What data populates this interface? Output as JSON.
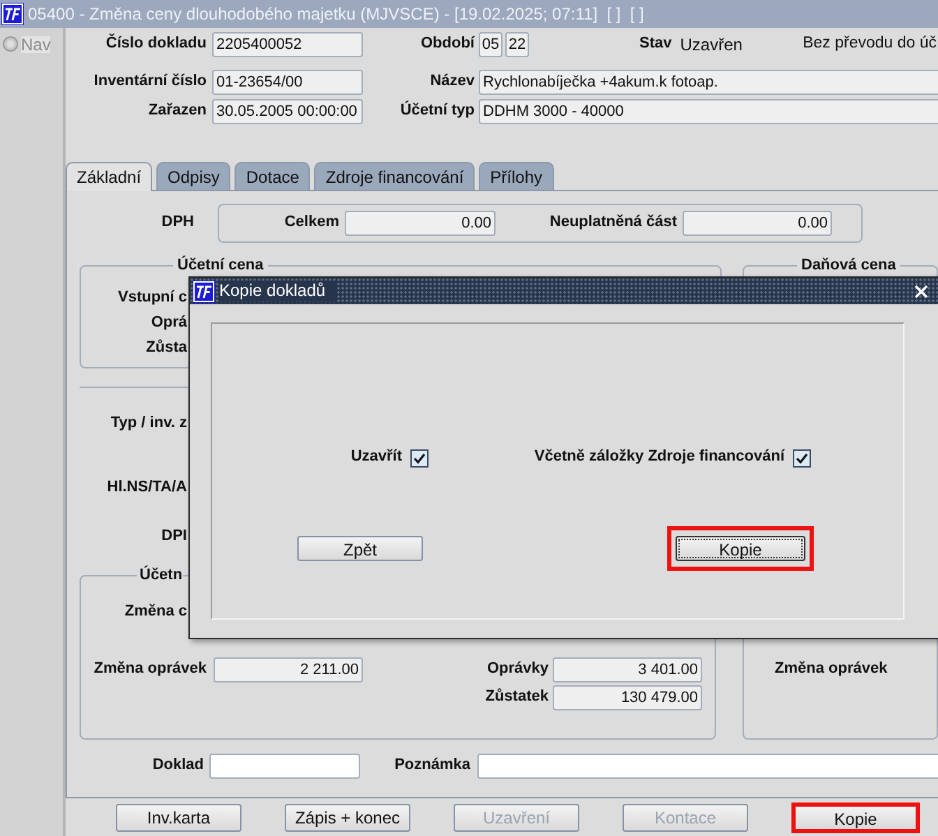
{
  "window": {
    "title": "05400 - Změna ceny dlouhodobého majetku (MJVSCE) - [19.02.2025; 07:11]  [ ]  [ ]"
  },
  "sidebar": {
    "items": [
      {
        "label": "Nav",
        "selected": false
      }
    ]
  },
  "header": {
    "cislo_dokladu": {
      "label": "Číslo dokladu",
      "value": "2205400052"
    },
    "obdobi": {
      "label": "Období",
      "values": [
        "05",
        "22"
      ]
    },
    "stav": {
      "label": "Stav",
      "value": "Uzavřen"
    },
    "note": "Bez převodu do úč",
    "inventarni_cislo": {
      "label": "Inventární číslo",
      "value": "01-23654/00"
    },
    "nazev": {
      "label": "Název",
      "value": "Rychlonabíječka +4akum.k fotoap."
    },
    "zarazen": {
      "label": "Zařazen",
      "value": "30.05.2005 00:00:00"
    },
    "ucetni_typ": {
      "label": "Účetní typ",
      "value": "DDHM 3000 - 40000"
    }
  },
  "tabs": [
    {
      "label": "Základní",
      "selected": true
    },
    {
      "label": "Odpisy",
      "selected": false
    },
    {
      "label": "Dotace",
      "selected": false
    },
    {
      "label": "Zdroje financování",
      "selected": false
    },
    {
      "label": "Přílohy",
      "selected": false
    }
  ],
  "panel": {
    "dph": {
      "label": "DPH",
      "celkem": {
        "label": "Celkem",
        "value": "0.00"
      },
      "neuplatnena_cast": {
        "label": "Neuplatněná část",
        "value": "0.00"
      }
    },
    "ucetni_cena": {
      "title": "Účetní cena",
      "labels": [
        "Vstupní c",
        "Oprá",
        "Zůsta"
      ]
    },
    "danova_cena": {
      "title": "Daňová cena"
    },
    "labels": [
      "Typ / inv. z",
      "Hl.NS/TA/A",
      "DPI"
    ],
    "ucetni_zmena": {
      "title": "Účetn",
      "label": "Změna c",
      "zmena_opravek": {
        "label": "Změna oprávek",
        "value": "2 211.00"
      },
      "opravky": {
        "label": "Oprávky",
        "value": "3 401.00"
      },
      "zustatek": {
        "label": "Zůstatek",
        "value": "130 479.00"
      }
    },
    "danova_zmena": {
      "label": "Změna oprávek"
    },
    "doklad": {
      "label": "Doklad"
    },
    "poznamka": {
      "label": "Poznámka"
    }
  },
  "buttons": [
    {
      "label": "Inv.karta",
      "disabled": false,
      "highlighted": false
    },
    {
      "label": "Zápis + konec",
      "disabled": false,
      "highlighted": false
    },
    {
      "label": "Uzavření",
      "disabled": true,
      "highlighted": false
    },
    {
      "label": "Kontace",
      "disabled": true,
      "highlighted": false
    },
    {
      "label": "Kopie",
      "disabled": false,
      "highlighted": true
    }
  ],
  "dialog": {
    "title": "Kopie dokladů",
    "options": [
      {
        "label": "Uzavřít",
        "checked": true
      },
      {
        "label": "Včetně záložky Zdroje financování",
        "checked": true
      }
    ],
    "buttons": [
      {
        "label": "Zpět",
        "focused": false,
        "highlighted": false
      },
      {
        "label": "Kopie",
        "focused": true,
        "highlighted": true
      }
    ]
  }
}
